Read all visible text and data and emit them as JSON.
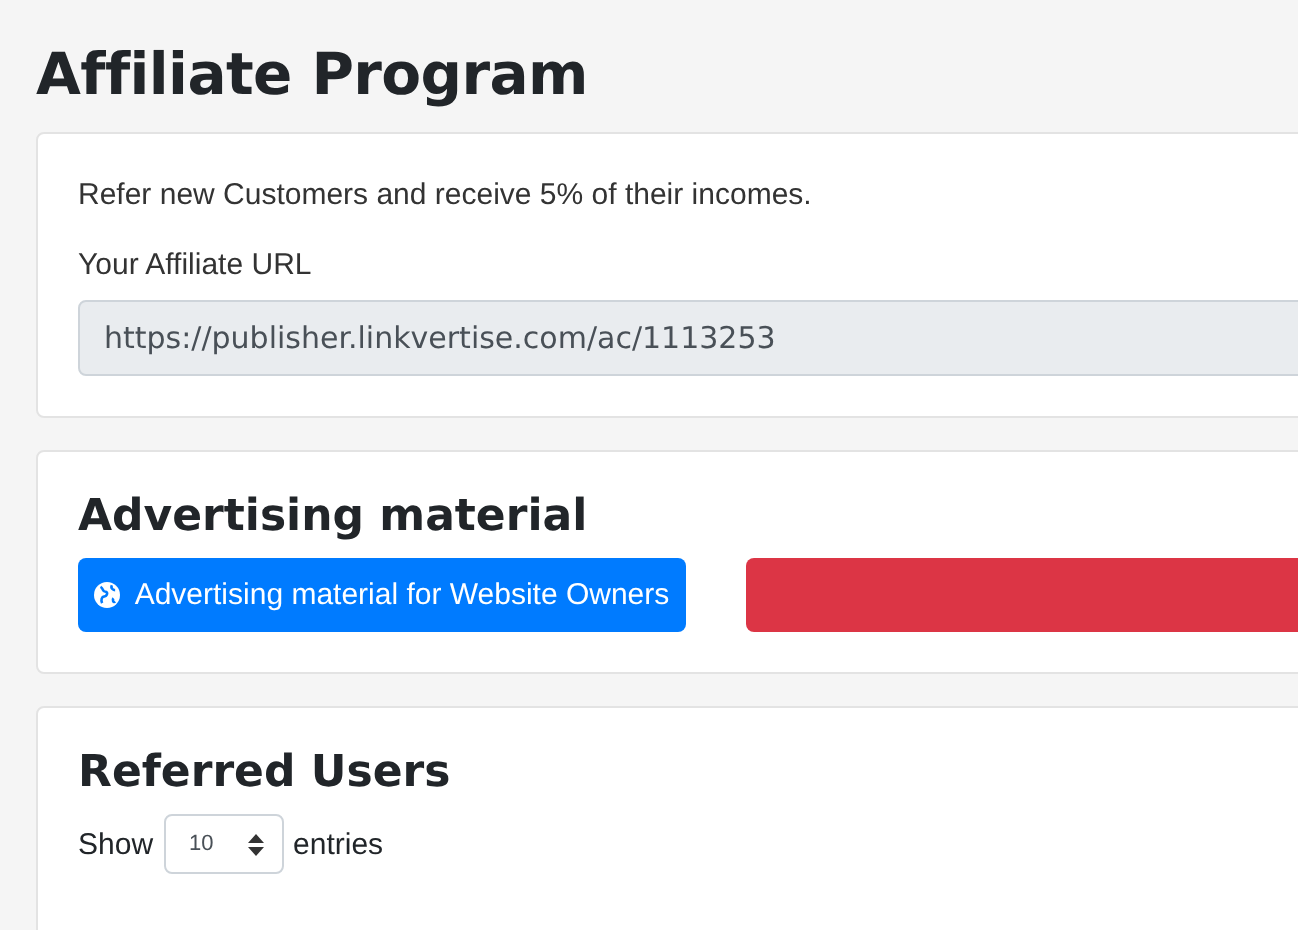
{
  "page_title": "Affiliate Program",
  "affiliate_card": {
    "description": "Refer new Customers and receive 5% of their incomes.",
    "url_label": "Your Affiliate URL",
    "url_value": "https://publisher.linkvertise.com/ac/1113253"
  },
  "advertising_card": {
    "title": "Advertising material",
    "buttons": [
      {
        "label": "Advertising material for Website Owners",
        "kind": "primary"
      },
      {
        "kind": "danger"
      }
    ]
  },
  "referred_card": {
    "title": "Referred Users",
    "show_label": "Show",
    "page_size": "10",
    "entries_label": "entries"
  }
}
